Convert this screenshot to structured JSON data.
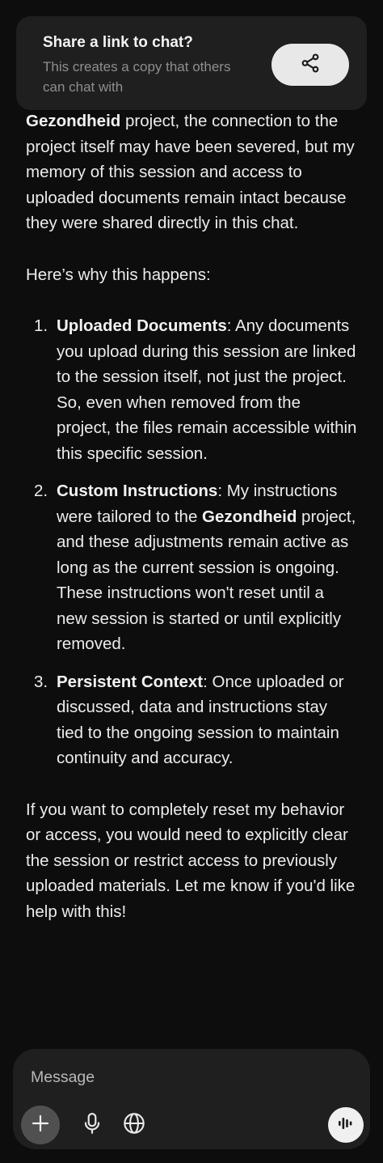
{
  "share_banner": {
    "title": "Share a link to chat?",
    "subtitle": "This creates a copy that others can chat with",
    "share_icon": "share-icon"
  },
  "message": {
    "intro_bold": "Gezondheid",
    "intro_text": " project, the connection to the project itself may have been severed, but my memory of this session and access to uploaded documents remain intact because they were shared directly in this chat.",
    "why_line": "Here’s why this happens:",
    "items": [
      {
        "number": "1.",
        "title": "Uploaded Documents",
        "text": ": Any documents you upload during this session are linked to the session itself, not just the project. So, even when removed from the project, the files remain accessible within this specific session."
      },
      {
        "number": "2.",
        "title": "Custom Instructions",
        "text_before": ": My instructions were tailored to the ",
        "bold_mid": "Gezondheid",
        "text_after": " project, and these adjustments remain active as long as the current session is ongoing. These instructions won't reset until a new session is started or until explicitly removed."
      },
      {
        "number": "3.",
        "title": "Persistent Context",
        "text": ": Once uploaded or discussed, data and instructions stay tied to the ongoing session to maintain continuity and accuracy."
      }
    ],
    "closing": "If you want to completely reset my behavior or access, you would need to explicitly clear the session or restrict access to previously uploaded materials. Let me know if you'd like help with this!"
  },
  "composer": {
    "placeholder": "Message",
    "icons": [
      "plus-icon",
      "microphone-icon",
      "globe-icon",
      "voice-waveform-icon"
    ]
  },
  "colors": {
    "background": "#0d0d0d",
    "card": "#1f1f1f",
    "text": "#ececec",
    "muted": "#8e8e8e",
    "button_light": "#e8e8e8"
  }
}
